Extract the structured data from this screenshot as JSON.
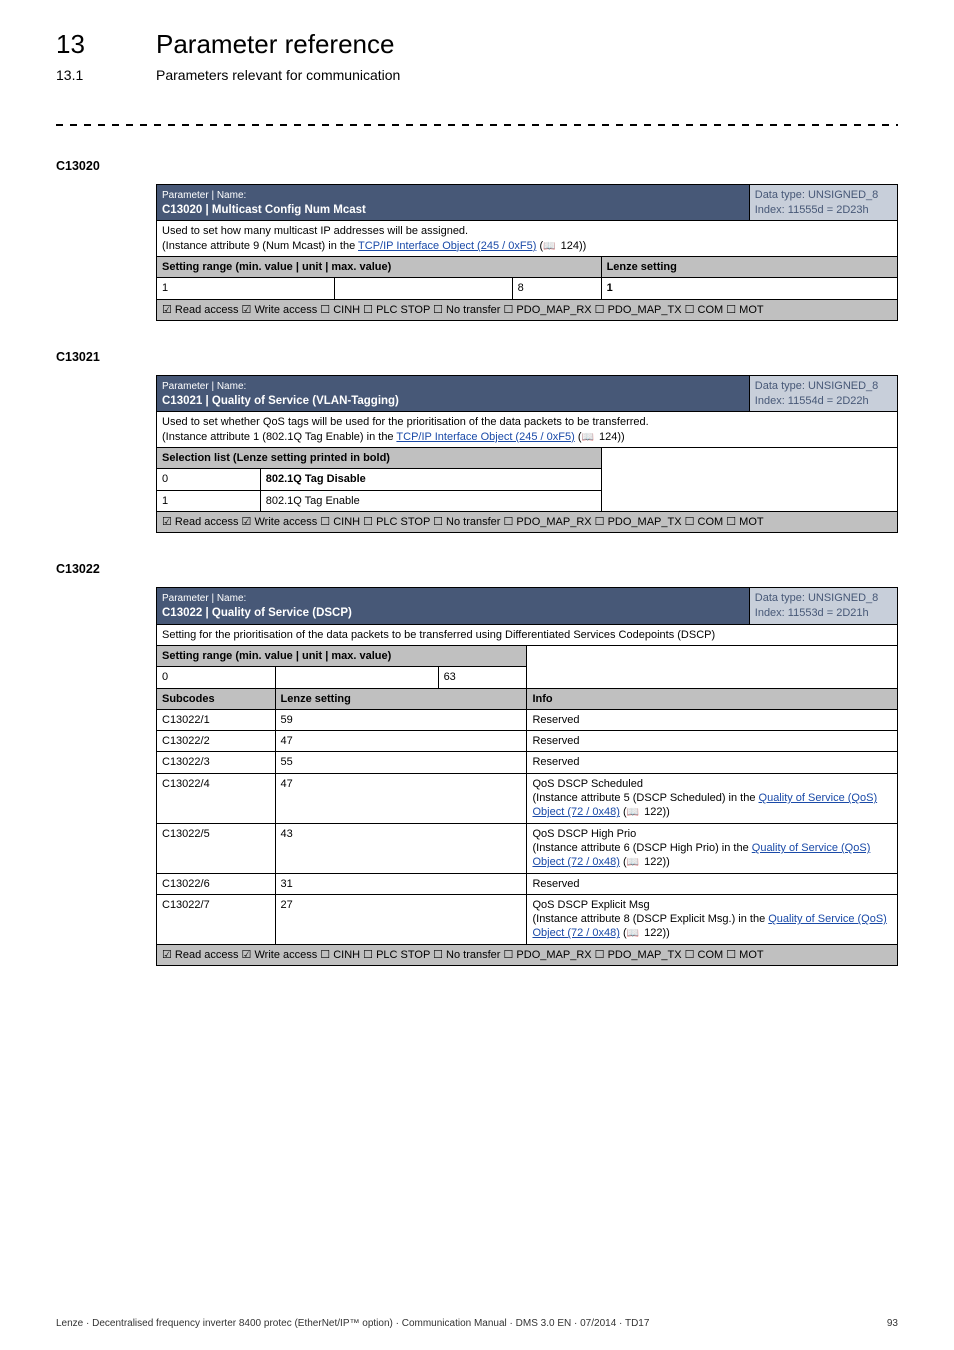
{
  "heading": {
    "chapter_num": "13",
    "chapter_title": "Parameter reference",
    "section_num": "13.1",
    "section_title": "Parameters relevant for communication"
  },
  "c13020": {
    "code": "C13020",
    "hdr_label": "Parameter | Name:",
    "hdr_name": "C13020 | Multicast Config Num Mcast",
    "hdr_type_line1": "Data type: UNSIGNED_8",
    "hdr_type_line2": "Index: 11555d = 2D23h",
    "desc_pre": "Used to set how many multicast IP addresses will be assigned.",
    "desc_inst_pre": "(Instance attribute 9 (Num Mcast) in the ",
    "desc_link": "TCP/IP Interface Object (245 / 0xF5)",
    "desc_ref": " 124))",
    "col_setting": "Setting range (min. value | unit | max. value)",
    "col_lenze": "Lenze setting",
    "min": "1",
    "unit": "",
    "max": "8",
    "default": "1",
    "access": "☑ Read access  ☑ Write access  ☐ CINH  ☐ PLC STOP  ☐ No transfer  ☐ PDO_MAP_RX  ☐ PDO_MAP_TX  ☐ COM  ☐ MOT"
  },
  "c13021": {
    "code": "C13021",
    "hdr_label": "Parameter | Name:",
    "hdr_name": "C13021 | Quality of Service (VLAN-Tagging)",
    "hdr_type_line1": "Data type: UNSIGNED_8",
    "hdr_type_line2": "Index: 11554d = 2D22h",
    "desc_line1": "Used to set whether QoS tags will be used for the prioritisation of the data packets to be transferred.",
    "desc_inst_pre": "(Instance attribute 1 (802.1Q Tag Enable) in the ",
    "desc_link": "TCP/IP Interface Object (245 / 0xF5)",
    "desc_ref": " 124))",
    "col_sel": "Selection list (Lenze setting printed in bold)",
    "row0_idx": "0",
    "row0_val": "802.1Q Tag Disable",
    "row1_idx": "1",
    "row1_val": "802.1Q Tag Enable",
    "access": "☑ Read access  ☑ Write access  ☐ CINH  ☐ PLC STOP  ☐ No transfer  ☐ PDO_MAP_RX  ☐ PDO_MAP_TX  ☐ COM  ☐ MOT"
  },
  "c13022": {
    "code": "C13022",
    "hdr_label": "Parameter | Name:",
    "hdr_name": "C13022 | Quality of Service (DSCP)",
    "hdr_type_line1": "Data type: UNSIGNED_8",
    "hdr_type_line2": "Index: 11553d = 2D21h",
    "desc": "Setting for the prioritisation of the data packets to be transferred using Differentiated Services Codepoints (DSCP)",
    "col_setting": "Setting range (min. value | unit | max. value)",
    "min": "0",
    "unit": "",
    "max": "63",
    "col_sub": "Subcodes",
    "col_lenze": "Lenze setting",
    "col_info": "Info",
    "rows": [
      {
        "sub": "C13022/1",
        "val": "59",
        "info": "Reserved"
      },
      {
        "sub": "C13022/2",
        "val": "47",
        "info": "Reserved"
      },
      {
        "sub": "C13022/3",
        "val": "55",
        "info": "Reserved"
      },
      {
        "sub": "C13022/4",
        "val": "47",
        "info_pre": "QoS DSCP Scheduled",
        "info_inst": "(Instance attribute 5 (DSCP Scheduled) in the ",
        "info_link": "Quality of Service (QoS) Object (72 / 0x48)",
        "info_ref": " 122))"
      },
      {
        "sub": "C13022/5",
        "val": "43",
        "info_pre": "QoS DSCP High Prio",
        "info_inst": "(Instance attribute 6 (DSCP High Prio) in the ",
        "info_link": "Quality of Service (QoS) Object (72 / 0x48)",
        "info_ref": " 122))"
      },
      {
        "sub": "C13022/6",
        "val": "31",
        "info": "Reserved"
      },
      {
        "sub": "C13022/7",
        "val": "27",
        "info_pre": "QoS DSCP Explicit Msg",
        "info_inst": "(Instance attribute 8 (DSCP Explicit Msg.) in the ",
        "info_link": "Quality of Service (QoS) Object (72 / 0x48)",
        "info_ref": " 122))"
      }
    ],
    "access": "☑ Read access  ☑ Write access  ☐ CINH  ☐ PLC STOP  ☐ No transfer  ☐ PDO_MAP_RX  ☐ PDO_MAP_TX  ☐ COM  ☐ MOT"
  },
  "footer": {
    "left": "Lenze · Decentralised frequency inverter 8400 protec (EtherNet/IP™ option) · Communication Manual · DMS 3.0 EN · 07/2014 · TD17",
    "right": "93"
  }
}
